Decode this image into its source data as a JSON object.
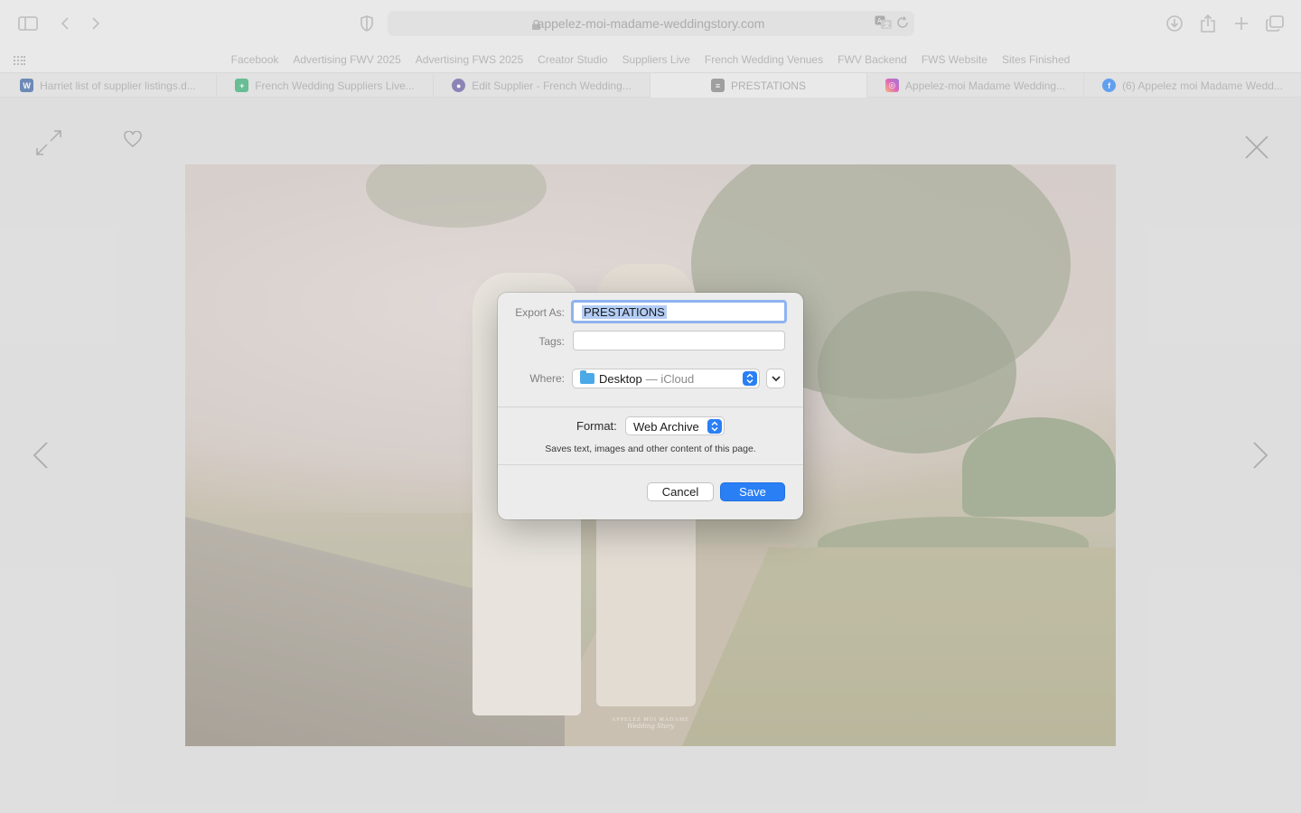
{
  "browser": {
    "url": "appelez-moi-madame-weddingstory.com",
    "bookmarks": [
      "Facebook",
      "Advertising FWV 2025",
      "Advertising FWS 2025",
      "Creator Studio",
      "Suppliers Live",
      "French Wedding Venues",
      "FWV Backend",
      "FWS Website",
      "Sites Finished"
    ],
    "tabs": [
      {
        "label": "Harriet list of supplier listings.d...",
        "favicon": "word-icon",
        "color": "#2b579a",
        "glyph": "W"
      },
      {
        "label": "French Wedding Suppliers Live...",
        "favicon": "sheets-icon",
        "color": "#23a566",
        "glyph": "+"
      },
      {
        "label": "Edit Supplier - French Wedding...",
        "favicon": "site-icon",
        "color": "#5a4e9a",
        "glyph": "●"
      },
      {
        "label": "PRESTATIONS",
        "favicon": "page-icon",
        "color": "#777777",
        "glyph": "≡"
      },
      {
        "label": "Appelez-moi Madame Wedding...",
        "favicon": "instagram-icon",
        "color": "#d6249f",
        "glyph": "◎"
      },
      {
        "label": "(6) Appelez moi Madame Wedd...",
        "favicon": "facebook-icon",
        "color": "#1877f2",
        "glyph": "f"
      }
    ]
  },
  "photo": {
    "watermark_line1": "APPELEZ MOI MADAME",
    "watermark_line2": "Wedding Story"
  },
  "dialog": {
    "export_label": "Export As:",
    "export_value": "PRESTATIONS",
    "tags_label": "Tags:",
    "where_label": "Where:",
    "where_value": "Desktop",
    "where_sub": "— iCloud",
    "format_label": "Format:",
    "format_value": "Web Archive",
    "description": "Saves text, images and other content of this page.",
    "cancel": "Cancel",
    "save": "Save"
  },
  "colors": {
    "accent": "#2a7ff5",
    "selection": "#b3cdf5"
  }
}
